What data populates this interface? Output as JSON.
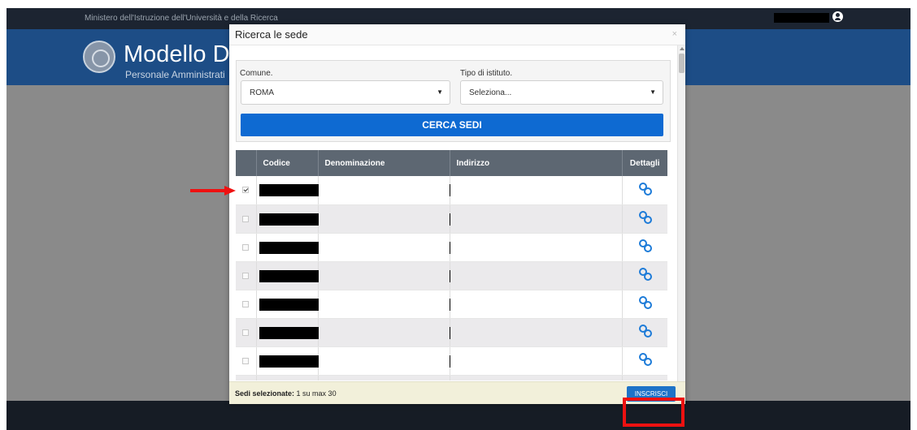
{
  "background": {
    "ministry": "Ministero dell'Istruzione dell'Università e della Ricerca",
    "app_title": "Modello D3",
    "app_subtitle": "Personale Amministrati",
    "footer_text": ""
  },
  "modal": {
    "title": "Ricerca le sede",
    "close": "×",
    "filters": {
      "comune_label": "Comune.",
      "comune_value": "ROMA",
      "tipo_label": "Tipo di istituto.",
      "tipo_value": "Seleziona...",
      "caret": "▼",
      "search_button": "CERCA SEDI"
    },
    "table": {
      "headers": [
        "",
        "Codice",
        "Denominazione",
        "Indirizzo",
        "Dettagli"
      ],
      "rows": [
        {
          "checked": true
        },
        {
          "checked": false
        },
        {
          "checked": false
        },
        {
          "checked": false
        },
        {
          "checked": false
        },
        {
          "checked": false
        },
        {
          "checked": false
        },
        {
          "checked": false
        }
      ]
    },
    "footer": {
      "status_label": "Sedi selezionate:",
      "status_value": "1 su max 30",
      "inscrivi_button": "INSCRISCI"
    }
  },
  "colors": {
    "header_blue": "#1d4d86",
    "primary_button": "#0e6ad2",
    "annotation_red": "#ee1111",
    "table_header": "#5d6772"
  }
}
